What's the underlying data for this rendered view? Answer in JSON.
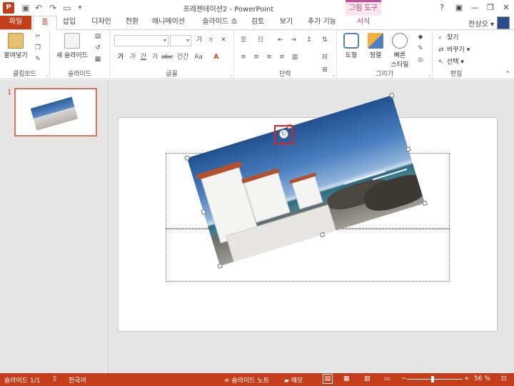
{
  "titlebar": {
    "app_icon_letter": "P",
    "title": "프레젠테이션2 - PowerPoint",
    "contextual_tab": "그림 도구",
    "help": "?",
    "minimize": "—",
    "restore": "❐",
    "close": "✕"
  },
  "tabs": [
    "파일",
    "홈",
    "삽입",
    "디자인",
    "전환",
    "애니메이션",
    "슬라이드 쇼",
    "검토",
    "보기",
    "추가 기능",
    "서식"
  ],
  "user": {
    "name": "전상오",
    "chevron": "▾"
  },
  "ribbon": {
    "clipboard": {
      "label": "클립보드",
      "paste": "붙여넣기"
    },
    "slides": {
      "label": "슬라이드",
      "new_slide": "새 슬라이드"
    },
    "font": {
      "label": "글꼴",
      "bold": "가",
      "italic": "가",
      "underline": "간",
      "strike": "가",
      "spacing": "간간",
      "case": "Aa",
      "grow": "가",
      "shrink": "가"
    },
    "paragraph": {
      "label": "단락"
    },
    "drawing": {
      "label": "그리기",
      "shapes": "도형",
      "arrange": "정렬",
      "quick_styles_line1": "빠른",
      "quick_styles_line2": "스타일"
    },
    "editing": {
      "label": "편집",
      "find": "찾기",
      "replace": "바꾸기",
      "select": "선택"
    }
  },
  "thumbnails": {
    "slide_number": "1"
  },
  "statusbar": {
    "slide_info": "슬라이드 1/1",
    "language": "한국어",
    "notes": "슬라이드 노트",
    "comments": "메모",
    "zoom_minus": "−",
    "zoom_plus": "+",
    "zoom_level": "56 %"
  },
  "colors": {
    "accent": "#c43e1c",
    "contextual": "#c0509a",
    "selection": "#e02020"
  }
}
